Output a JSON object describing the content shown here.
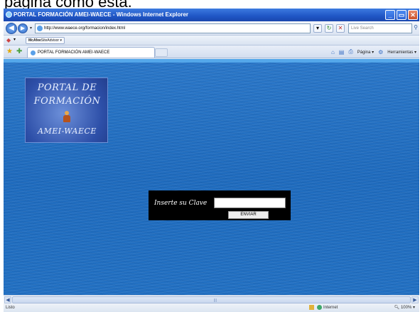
{
  "caption": "página como ésta.",
  "window": {
    "title": "PORTAL FORMACIÓN AMEI-WAECE - Windows Internet Explorer",
    "buttons": {
      "minimize": "_",
      "maximize": "▭",
      "close": "✕"
    }
  },
  "navbar": {
    "back": "◀",
    "forward": "▶",
    "address": "http://www.waece.org/formacion/index.html",
    "refresh": "↻",
    "stop": "✕",
    "search_placeholder": "Live Search",
    "search_go": "⚲"
  },
  "linksbar": {
    "mcafee_brand": "McAfee",
    "mcafee_product": "SiteAdvisor ▾"
  },
  "tabbar": {
    "tab_label": "PORTAL FORMACIÓN AMEI-WAECE",
    "page_menu": "Página ▾",
    "tools_menu": "Herramientas ▾"
  },
  "page": {
    "logo": {
      "line1": "PORTAL DE",
      "line2": "FORMACIÓN",
      "line3": "AMEI-WAECE"
    },
    "login": {
      "label": "Inserte su Clave",
      "input_value": "",
      "submit": "ENVIAR"
    }
  },
  "hscroll": {
    "left": "◀",
    "right": "▶",
    "grip": "|||"
  },
  "statusbar": {
    "status": "Listo",
    "zone": "Internet",
    "zoom": "100%"
  }
}
